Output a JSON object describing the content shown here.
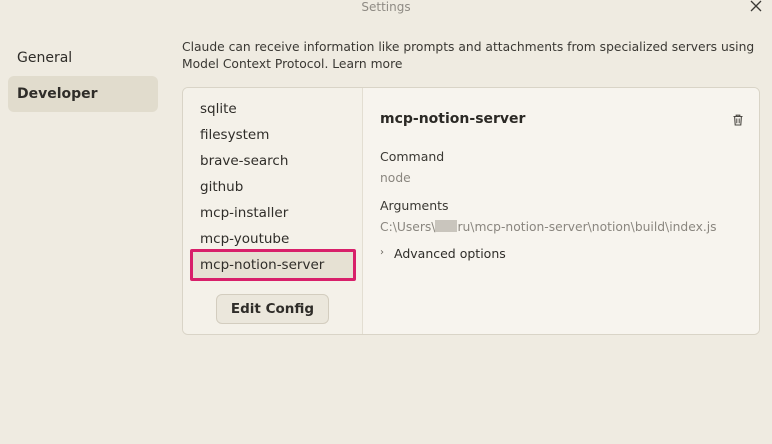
{
  "window": {
    "title": "Settings"
  },
  "nav": {
    "items": [
      {
        "label": "General"
      },
      {
        "label": "Developer"
      }
    ]
  },
  "intro": {
    "text": "Claude can receive information like prompts and attachments from specialized servers using Model Context Protocol.",
    "link": "Learn more"
  },
  "servers": [
    {
      "label": "sqlite"
    },
    {
      "label": "filesystem"
    },
    {
      "label": "brave-search"
    },
    {
      "label": "github"
    },
    {
      "label": "mcp-installer"
    },
    {
      "label": "mcp-youtube"
    },
    {
      "label": "mcp-notion-server"
    }
  ],
  "edit_config_label": "Edit Config",
  "details": {
    "title": "mcp-notion-server",
    "command_label": "Command",
    "command_value": "node",
    "arguments_label": "Arguments",
    "arguments_prefix": "C:\\Users\\",
    "arguments_suffix": "ru\\mcp-notion-server\\notion\\build\\index.js",
    "advanced_label": "Advanced options"
  },
  "colors": {
    "highlight": "#d8206a",
    "background": "#efebe1",
    "active_nav": "#e1dccd"
  },
  "icons": {
    "close": "close-icon",
    "delete": "trash-icon",
    "expand": "chevron-right-icon"
  }
}
